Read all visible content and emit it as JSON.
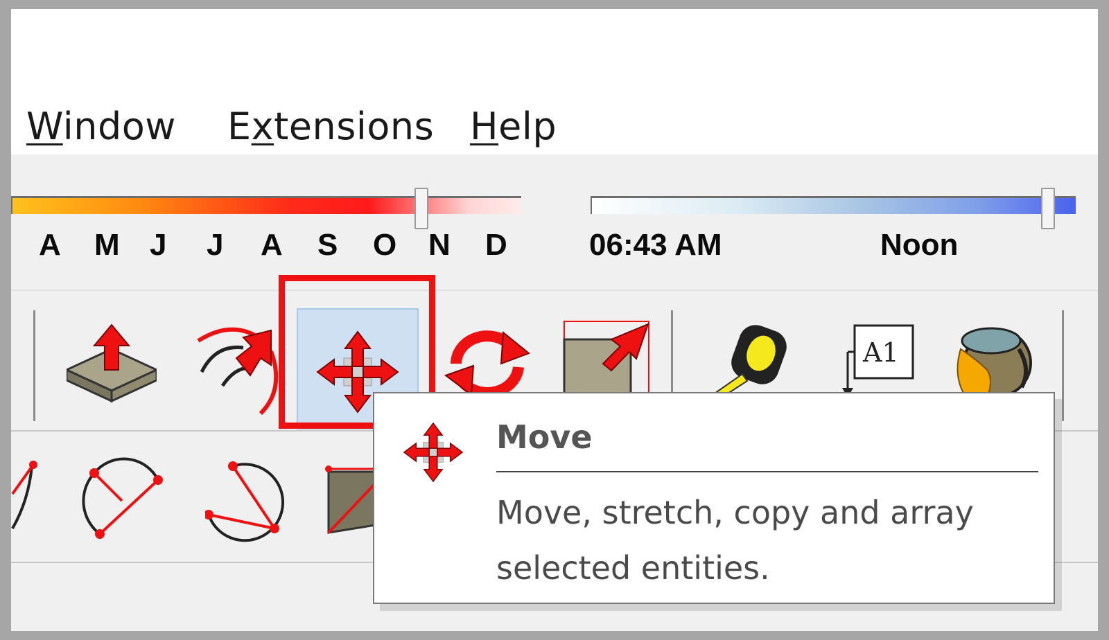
{
  "menu": {
    "items": [
      {
        "label": "Window",
        "accel": "W"
      },
      {
        "label": "Extensions",
        "accel": "x"
      },
      {
        "label": "Help",
        "accel": "H"
      }
    ]
  },
  "shadows": {
    "months": [
      "A",
      "M",
      "J",
      "J",
      "A",
      "S",
      "O",
      "N",
      "D"
    ],
    "time_start": "06:43 AM",
    "time_mid": "Noon",
    "colors": {
      "month_gradient": [
        "#ffc21c",
        "#ff2a1a",
        "#ffeaea"
      ],
      "time_gradient": [
        "#ffffff",
        "#a9c6e4",
        "#4a62ee"
      ]
    }
  },
  "toolbar": {
    "row1_icons": [
      "push-pull-icon",
      "follow-me-icon",
      "move-icon",
      "rotate-icon",
      "scale-icon",
      "tape-measure-icon",
      "text-label-icon",
      "paint-bucket-icon"
    ],
    "row2_icons": [
      "arc-icon",
      "three-point-arc-icon",
      "pie-icon",
      "rectangle-icon"
    ],
    "highlight_color": "#ee1111",
    "active_tool": "Move"
  },
  "tooltip": {
    "title": "Move",
    "description": "Move, stretch, copy and array selected entities."
  }
}
